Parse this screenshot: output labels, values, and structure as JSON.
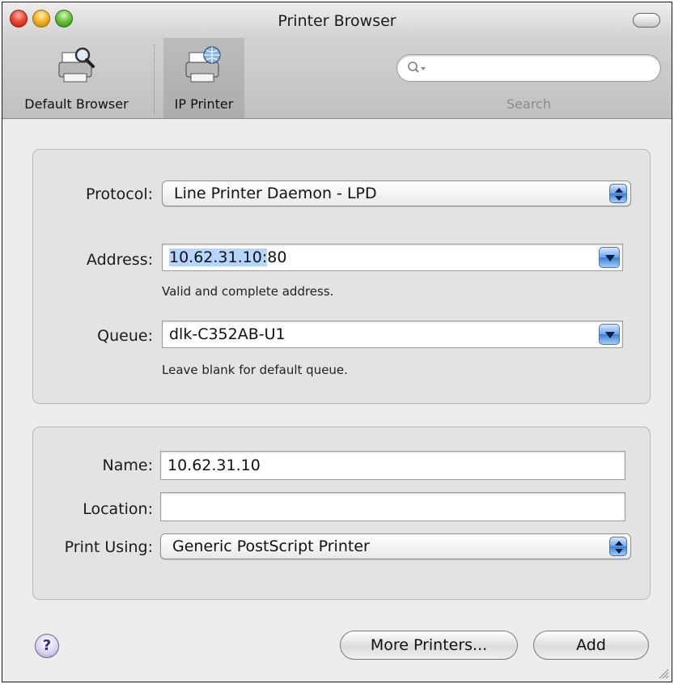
{
  "window": {
    "title": "Printer Browser"
  },
  "toolbar": {
    "items": [
      {
        "label": "Default Browser",
        "icon": "printer-magnifier-icon"
      },
      {
        "label": "IP Printer",
        "icon": "printer-globe-icon",
        "selected": true
      }
    ],
    "search": {
      "value": "",
      "label": "Search"
    }
  },
  "connection": {
    "protocol": {
      "label": "Protocol:",
      "value": "Line Printer Daemon - LPD"
    },
    "address": {
      "label": "Address:",
      "value_selected": "10.62.31.10:",
      "value_rest": "80",
      "hint": "Valid and complete address."
    },
    "queue": {
      "label": "Queue:",
      "value": "dlk-C352AB-U1",
      "hint": "Leave blank for default queue."
    }
  },
  "details": {
    "name": {
      "label": "Name:",
      "value": "10.62.31.10"
    },
    "location": {
      "label": "Location:",
      "value": ""
    },
    "print_using": {
      "label": "Print Using:",
      "value": "Generic PostScript Printer"
    }
  },
  "buttons": {
    "help": "?",
    "more_printers": "More Printers...",
    "add": "Add"
  },
  "colors": {
    "selection": "#b5d5ff",
    "accent_blue": "#3a7fd6"
  }
}
